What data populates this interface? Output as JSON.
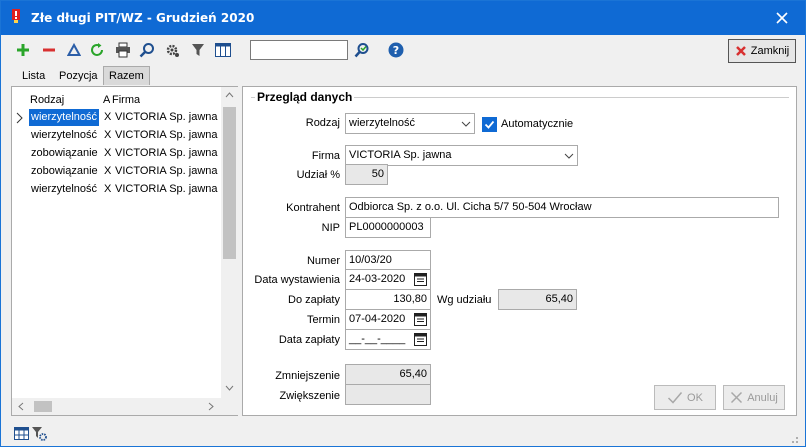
{
  "window": {
    "title": "Złe długi PIT/WZ - Grudzień 2020"
  },
  "toolbar": {
    "close_label": "Zamknij",
    "search_value": ""
  },
  "tabs": [
    {
      "label": "Lista"
    },
    {
      "label": "Pozycja"
    },
    {
      "label": "Razem"
    }
  ],
  "grid": {
    "headers": {
      "rodzaj": "Rodzaj",
      "a": "A",
      "firma": "Firma"
    },
    "rows": [
      {
        "rodzaj": "wierzytelność",
        "a": "X",
        "firma": "VICTORIA Sp. jawna"
      },
      {
        "rodzaj": "wierzytelność",
        "a": "X",
        "firma": "VICTORIA Sp. jawna"
      },
      {
        "rodzaj": "zobowiązanie",
        "a": "X",
        "firma": "VICTORIA Sp. jawna"
      },
      {
        "rodzaj": "zobowiązanie",
        "a": "X",
        "firma": "VICTORIA Sp. jawna"
      },
      {
        "rodzaj": "wierzytelność",
        "a": "X",
        "firma": "VICTORIA Sp. jawna"
      }
    ]
  },
  "form": {
    "group_title": "Przegląd danych",
    "rodzaj_label": "Rodzaj",
    "rodzaj_value": "wierzytelność",
    "auto_label": "Automatycznie",
    "firma_label": "Firma",
    "firma_value": "VICTORIA Sp. jawna",
    "udzial_label": "Udział %",
    "udzial_value": "50",
    "kontrahent_label": "Kontrahent",
    "kontrahent_value": "Odbiorca Sp. z o.o. Ul. Cicha 5/7 50-504 Wrocław",
    "nip_label": "NIP",
    "nip_value": "PL0000000003",
    "numer_label": "Numer",
    "numer_value": "10/03/20",
    "data_wyst_label": "Data wystawienia",
    "data_wyst_value": "24-03-2020",
    "do_zaplaty_label": "Do zapłaty",
    "do_zaplaty_value": "130,80",
    "wg_udzialu_label": "Wg udziału",
    "wg_udzialu_value": "65,40",
    "termin_label": "Termin",
    "termin_value": "07-04-2020",
    "data_zaplaty_label": "Data zapłaty",
    "data_zaplaty_value": "__-__-____",
    "zmniejszenie_label": "Zmniejszenie",
    "zmniejszenie_value": "65,40",
    "zwiekszenie_label": "Zwiększenie",
    "zwiekszenie_value": "",
    "ok_label": "OK",
    "anuluj_label": "Anuluj"
  },
  "colors": {
    "title_bar": "#0f6ad4",
    "selection": "#0f6ad4",
    "checkbox": "#0f6ad4"
  }
}
